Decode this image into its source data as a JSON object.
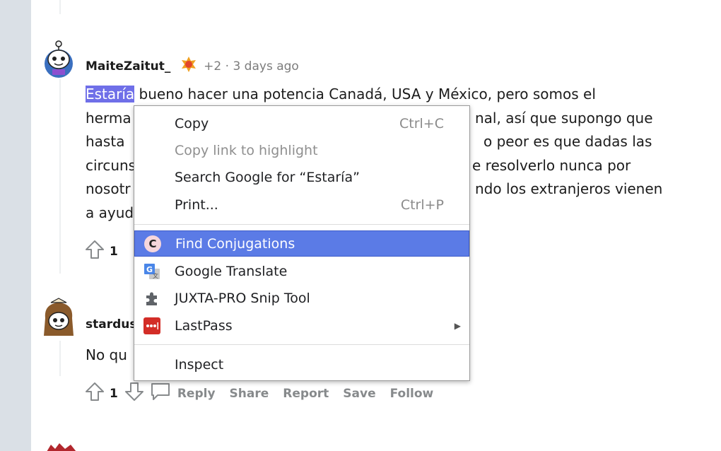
{
  "comment1": {
    "author": "MaiteZaitut_",
    "karma": "+2",
    "separator": "·",
    "time": "3 days ago",
    "selected_word": "Estaría",
    "line1_rest": " bueno hacer una potencia Canadá, USA y México, pero somos el",
    "line2_left": "herma",
    "line2_right": "nal, así que supongo que",
    "line3_left": "hasta",
    "line3_right": "o peor es que dadas las",
    "line4_left": "circuns",
    "line4_right": "e resolverlo nunca por",
    "line5_left": "nosotr",
    "line5_right": "ndo los extranjeros vienen",
    "line6_left": "a ayud",
    "votes": "1"
  },
  "comment2": {
    "author_partial": "stardus",
    "text_partial": "No qu",
    "votes": "1",
    "actions": {
      "reply": "Reply",
      "share": "Share",
      "report": "Report",
      "save": "Save",
      "follow": "Follow"
    }
  },
  "context_menu": {
    "copy": {
      "label": "Copy",
      "shortcut": "Ctrl+C"
    },
    "copy_link": {
      "label": "Copy link to highlight"
    },
    "search": {
      "label": "Search Google for “Estaría”"
    },
    "print": {
      "label": "Print...",
      "shortcut": "Ctrl+P"
    },
    "find_conjugations": {
      "label": "Find Conjugations",
      "icon_letter": "C"
    },
    "google_translate": {
      "label": "Google Translate"
    },
    "juxta": {
      "label": "JUXTA-PRO Snip Tool"
    },
    "lastpass": {
      "label": "LastPass",
      "icon_text": "•••"
    },
    "inspect": {
      "label": "Inspect"
    }
  },
  "colors": {
    "selection": "#6f6fe8",
    "menu_highlight": "#5b7be6",
    "lastpass_red": "#d32d27"
  }
}
